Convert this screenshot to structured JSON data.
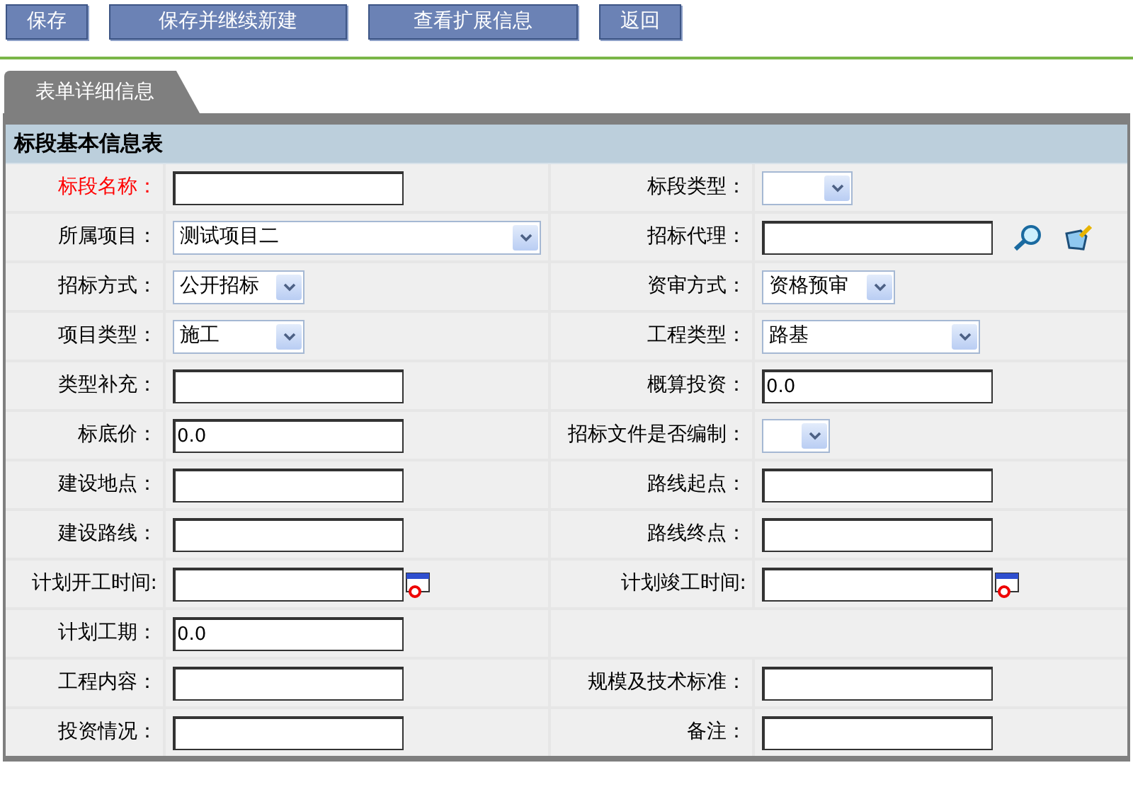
{
  "toolbar": {
    "buttons": [
      "保存",
      "保存并继续新建",
      "查看扩展信息",
      "返回"
    ]
  },
  "tabs": [
    {
      "label": "表单详细信息",
      "selected": true
    }
  ],
  "section": {
    "title": "标段基本信息表"
  },
  "rows": [
    {
      "left": {
        "label": "标段名称：",
        "kind": "text",
        "required": true
      },
      "right": {
        "label": "标段类型：",
        "kind": "select",
        "required": false
      }
    },
    {
      "left": {
        "label": "所属项目：",
        "kind": "select",
        "value": "测试项目二",
        "required": false
      },
      "right": {
        "label": "招标代理：",
        "kind": "lookup",
        "required": false
      }
    },
    {
      "left": {
        "label": "招标方式：",
        "kind": "select",
        "value": "公开招标",
        "required": false
      },
      "right": {
        "label": "资审方式：",
        "kind": "select",
        "value": "资格预审",
        "required": false
      }
    },
    {
      "left": {
        "label": "项目类型：",
        "kind": "select",
        "value": "施工",
        "required": false
      },
      "right": {
        "label": "工程类型：",
        "kind": "select",
        "value": "路基",
        "required": false
      }
    },
    {
      "left": {
        "label": "类型补充：",
        "kind": "text",
        "required": false
      },
      "right": {
        "label": "概算投资：",
        "kind": "text",
        "value": "0.0",
        "required": false
      }
    },
    {
      "left": {
        "label": "标底价：",
        "kind": "text",
        "value": "0.0",
        "required": false
      },
      "right": {
        "label": "招标文件是否编制：",
        "kind": "select",
        "required": false
      }
    },
    {
      "left": {
        "label": "建设地点：",
        "kind": "text",
        "required": false
      },
      "right": {
        "label": "路线起点：",
        "kind": "text",
        "required": false
      }
    },
    {
      "left": {
        "label": "建设路线：",
        "kind": "text",
        "required": false
      },
      "right": {
        "label": "路线终点：",
        "kind": "text",
        "required": false
      }
    },
    {
      "left": {
        "label": "计划开工时间:",
        "kind": "date",
        "required": false
      },
      "right": {
        "label": "计划竣工时间:",
        "kind": "date",
        "required": false
      }
    },
    {
      "left": {
        "label": "计划工期：",
        "kind": "text",
        "value": "0.0",
        "required": false
      }
    },
    {
      "left": {
        "label": "工程内容：",
        "kind": "text",
        "required": false
      },
      "right": {
        "label": "规模及技术标准：",
        "kind": "text",
        "required": false
      }
    },
    {
      "left": {
        "label": "投资情况：",
        "kind": "text",
        "required": false
      },
      "right": {
        "label": "备注：",
        "kind": "text",
        "required": false
      }
    }
  ]
}
